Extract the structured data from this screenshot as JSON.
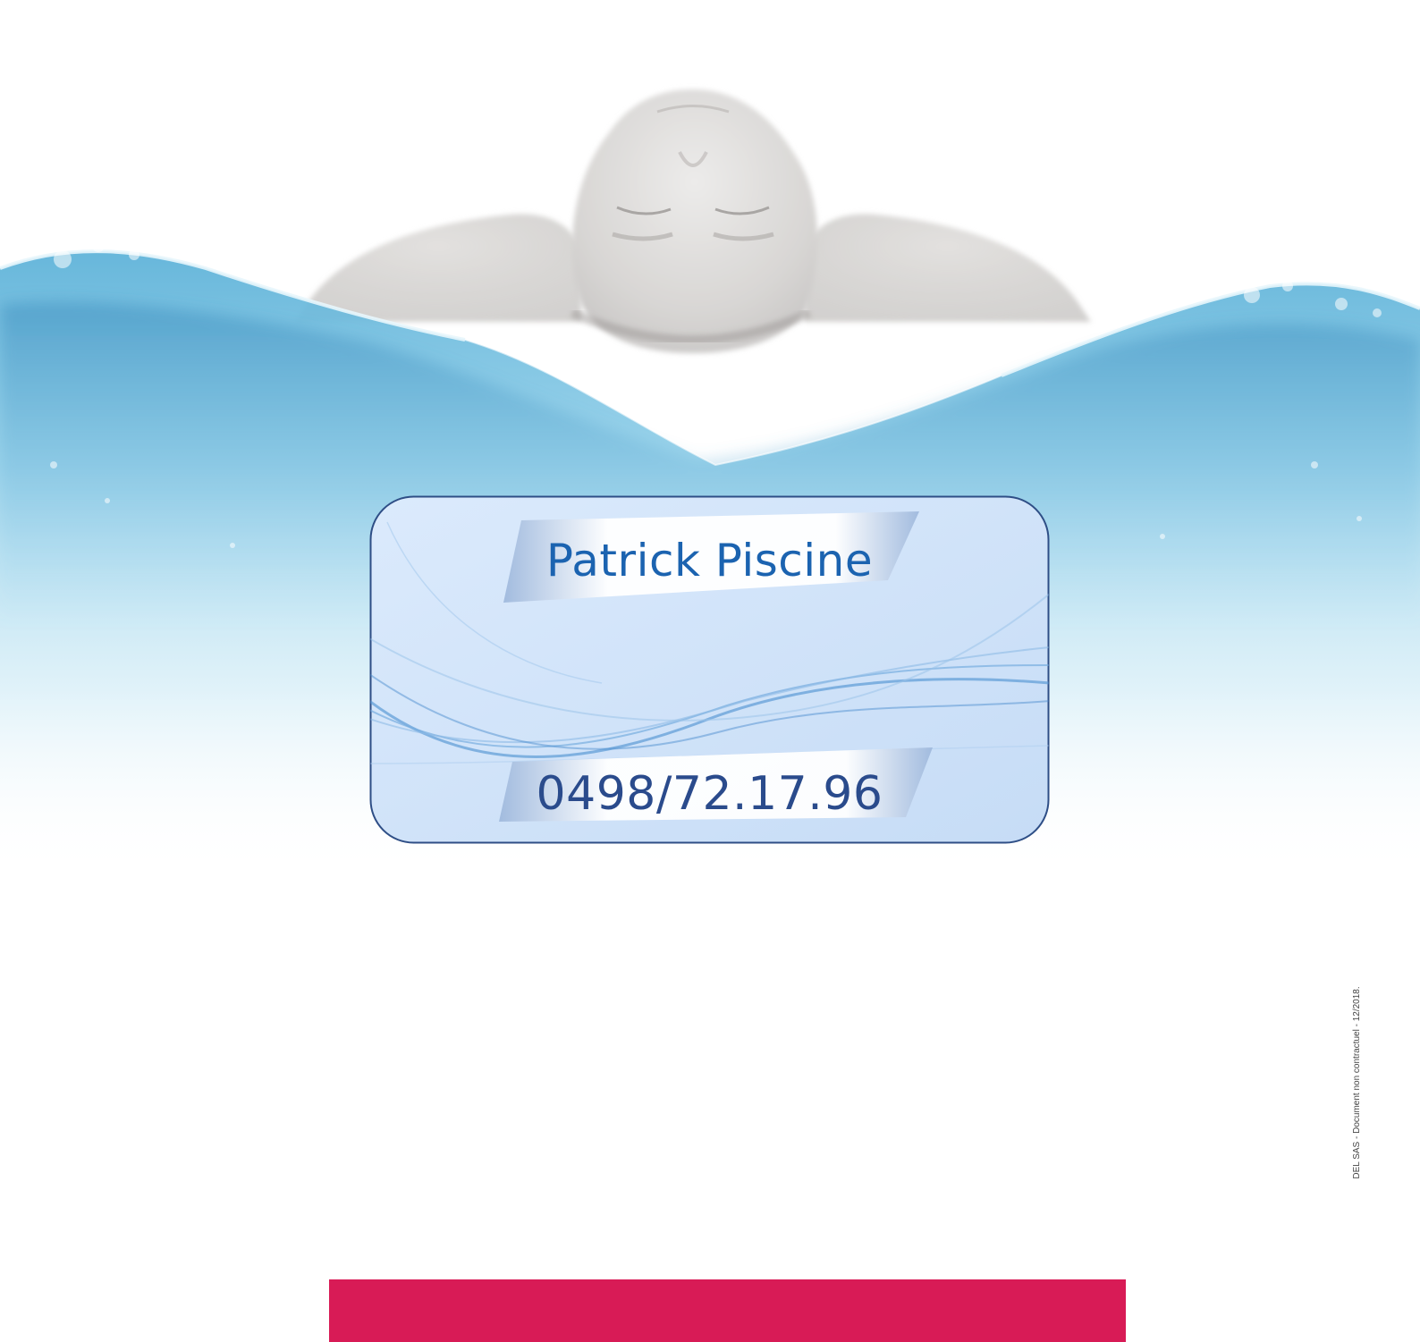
{
  "card": {
    "company_name": "Patrick Piscine",
    "phone": "0498/72.17.96"
  },
  "legal_note": "DEL SAS - Document non contractuel - 12/2018.",
  "colors": {
    "water": "#7fc6e6",
    "card_fill": "#cfe3f8",
    "card_border": "#2e4e86",
    "company_text": "#1b63b0",
    "phone_text": "#2a4b8c",
    "footer_bar": "#d81b56"
  }
}
